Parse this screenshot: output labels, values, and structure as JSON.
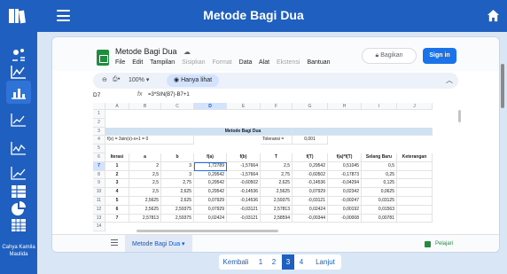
{
  "app": {
    "title": "Metode Bagi Dua",
    "user_name": "Cahya Kamila Maulida"
  },
  "sidebar": {
    "icons": [
      "transform-icon",
      "function-icon",
      "bar-chart-icon",
      "line-chart-icon",
      "scatter-chart-icon",
      "trend-chart-icon",
      "table-icon",
      "pie-chart-icon",
      "grid-icon"
    ],
    "active_index": 2
  },
  "sheet": {
    "doc_title": "Metode Bagi Dua",
    "menu": [
      "File",
      "Edit",
      "Tampilan",
      "Sisipkan",
      "Format",
      "Data",
      "Alat",
      "Ekstensi",
      "Bantuan"
    ],
    "disabled_menu": [
      "Sisipkan",
      "Format",
      "Ekstensi"
    ],
    "share_label": "Bagikan",
    "signin_label": "Sign in",
    "zoom": "100%",
    "view_only_label": "Hanya lihat",
    "cell_ref": "D7",
    "formula": "=3*SIN(B7)-B7+1",
    "tab_name": "Metode Bagi Dua",
    "learn_label": "Pelajari",
    "columns": [
      "A",
      "B",
      "C",
      "D",
      "E",
      "F",
      "G",
      "H",
      "I",
      "J"
    ],
    "row_numbers": [
      "1",
      "2",
      "3",
      "4",
      "5",
      "6",
      "7",
      "8",
      "9",
      "10",
      "11",
      "12",
      "13",
      "14"
    ],
    "selected_row": "7",
    "selected_col": "D",
    "section_title": "Metode Bagi Dua",
    "function_label": "f(x) = 3sin(x)-x+1 = 0",
    "tolerance_label": "Toleransi =",
    "tolerance_value": "0,001",
    "headers": [
      "Iterasi",
      "a",
      "b",
      "f(a)",
      "f(b)",
      "T",
      "f(T)",
      "f(a)*f(T)",
      "Selang Baru",
      "Keterangan"
    ],
    "rows": [
      [
        "1",
        "2",
        "3",
        "1,72789",
        "-1,57664",
        "2,5",
        "0,29542",
        "0,51045",
        "0,5",
        ""
      ],
      [
        "2",
        "2,5",
        "3",
        "0,29542",
        "-1,57664",
        "2,75",
        "-0,60502",
        "-0,17873",
        "0,25",
        ""
      ],
      [
        "3",
        "2,5",
        "2,75",
        "0,29542",
        "-0,60502",
        "2,625",
        "-0,14536",
        "-0,04294",
        "0,125",
        ""
      ],
      [
        "4",
        "2,5",
        "2,625",
        "0,29542",
        "-0,14536",
        "2,5625",
        "0,07929",
        "0,02342",
        "0,0625",
        ""
      ],
      [
        "5",
        "2,5625",
        "2,625",
        "0,07929",
        "-0,14536",
        "2,59375",
        "-0,03121",
        "-0,00247",
        "0,03125",
        ""
      ],
      [
        "6",
        "2,5625",
        "2,59375",
        "0,07929",
        "-0,03121",
        "2,57813",
        "0,02424",
        "0,00192",
        "0,01563",
        ""
      ],
      [
        "7",
        "2,57813",
        "2,59375",
        "0,02424",
        "-0,03121",
        "2,58594",
        "-0,00344",
        "-0,00008",
        "0,00781",
        ""
      ]
    ]
  },
  "pagination": {
    "prev": "Kembali",
    "pages": [
      "1",
      "2",
      "3",
      "4"
    ],
    "active": "3",
    "next": "Lanjut"
  },
  "colors": {
    "primary": "#1f5fbf",
    "background": "#d9e6f5",
    "sheets_green": "#1e8e3e",
    "signin_blue": "#1a73e8"
  }
}
